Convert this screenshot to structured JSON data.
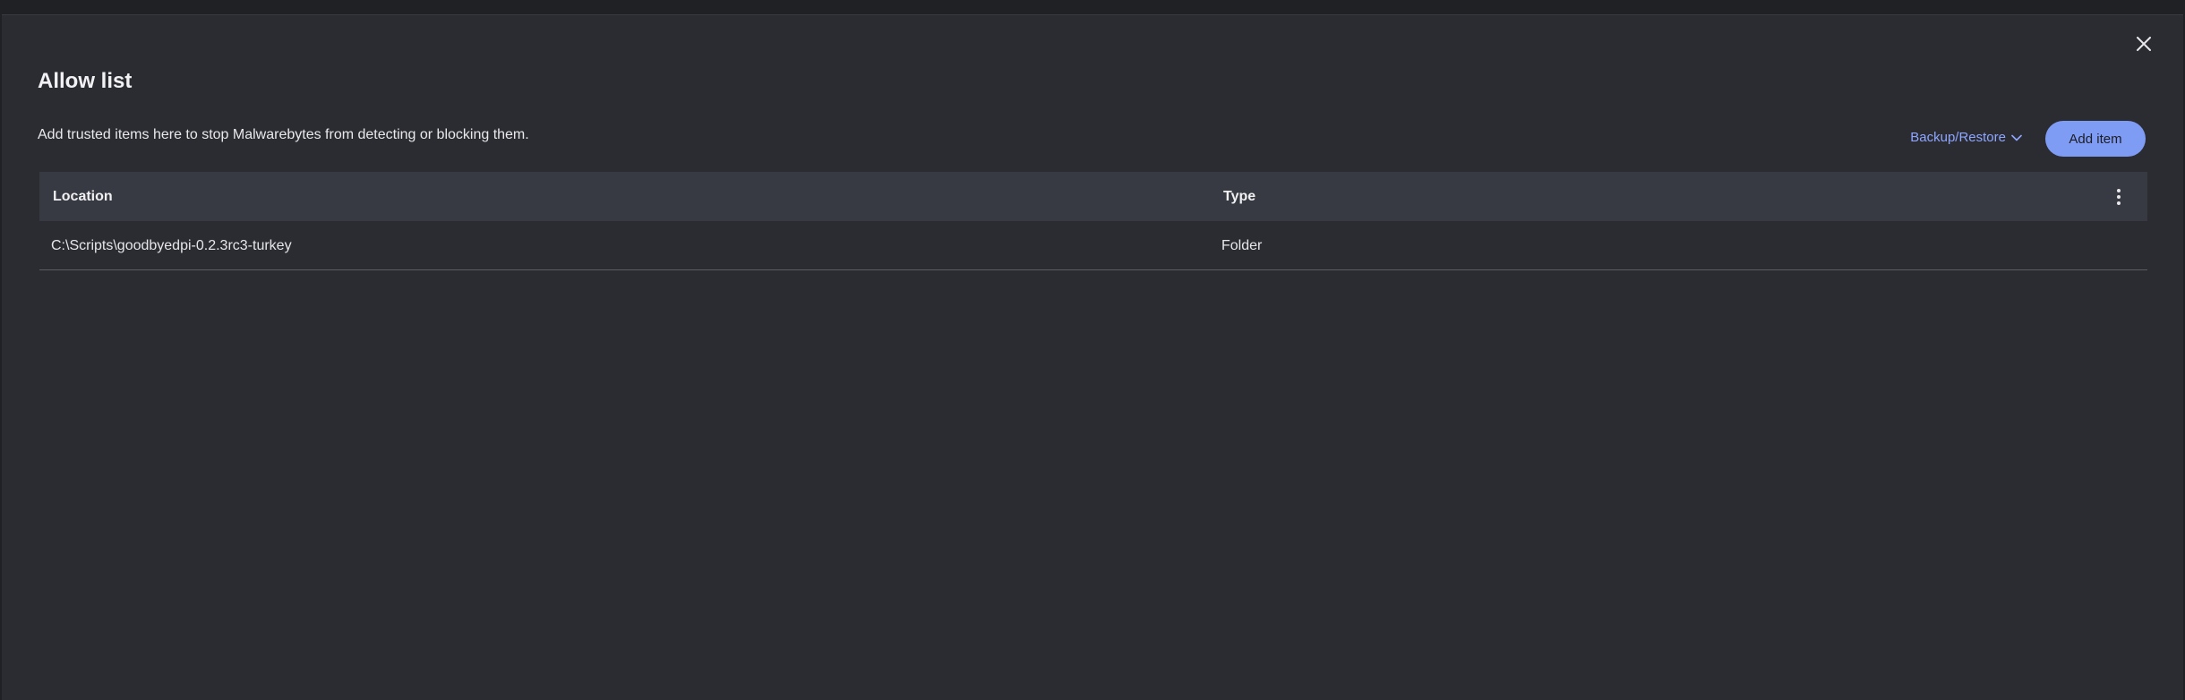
{
  "dialog": {
    "title": "Allow list",
    "subtitle": "Add trusted items here to stop Malwarebytes from detecting or blocking them.",
    "close_icon": "close-icon"
  },
  "actions": {
    "backup_label": "Backup/Restore",
    "backup_icon": "chevron-down-icon",
    "add_label": "Add item",
    "accent": "#7f9cf5",
    "link_color": "#8ea6ff"
  },
  "table": {
    "columns": [
      "Location",
      "Type"
    ],
    "menu_icon": "kebab-menu-icon",
    "rows": [
      {
        "location": "C:\\Scripts\\goodbyedpi-0.2.3rc3-turkey",
        "type": "Folder"
      }
    ]
  }
}
